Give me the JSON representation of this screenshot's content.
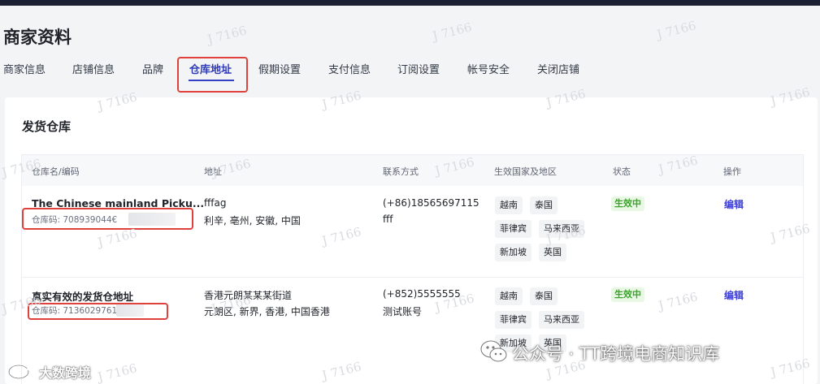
{
  "header": {
    "title": "商家资料"
  },
  "tabs": [
    {
      "label": "商家信息"
    },
    {
      "label": "店铺信息"
    },
    {
      "label": "品牌"
    },
    {
      "label": "仓库地址"
    },
    {
      "label": "假期设置"
    },
    {
      "label": "支付信息"
    },
    {
      "label": "订阅设置"
    },
    {
      "label": "帐号安全"
    },
    {
      "label": "关闭店铺"
    }
  ],
  "active_tab": "仓库地址",
  "section": {
    "title": "发货仓库"
  },
  "table": {
    "columns": [
      "仓库名/编码",
      "地址",
      "联系方式",
      "生效国家及地区",
      "状态",
      "操作"
    ],
    "rows": [
      {
        "name": "The Chinese mainland Picku...",
        "code": "仓库码: 708939044€",
        "address_line1": "fffag",
        "address_line2": "利辛, 亳州, 安徽, 中国",
        "phone": "(+86)18565697115",
        "contact_name": "fff",
        "regions": [
          "越南",
          "泰国",
          "菲律宾",
          "马来西亚",
          "新加坡",
          "英国"
        ],
        "status": "生效中",
        "action": "编辑"
      },
      {
        "name": "真实有效的发货仓地址",
        "code": "仓库码: 7136029761",
        "address_line1": "香港元朗某某某街道",
        "address_line2": "元朗区, 新界, 香港, 中国香港",
        "phone": "(+852)5555555",
        "contact_name": "测试账号",
        "regions": [
          "越南",
          "泰国",
          "菲律宾",
          "马来西亚",
          "新加坡",
          "英国"
        ],
        "status": "生效中",
        "action": "编辑"
      }
    ]
  },
  "watermark": {
    "text": "J 7166",
    "bottom_left_logo_text": "大数跨境",
    "bottom_right_brand_text": "公众号 · TT跨境电商知识库"
  },
  "colors": {
    "accent": "#3340c4",
    "highlight_box": "#e0413d",
    "status_green": "#3aa52a",
    "link": "#3d3fd8"
  },
  "icons": {
    "bottom_left": "weibo-logo-icon",
    "bottom_right": "wechat-logo-icon"
  }
}
